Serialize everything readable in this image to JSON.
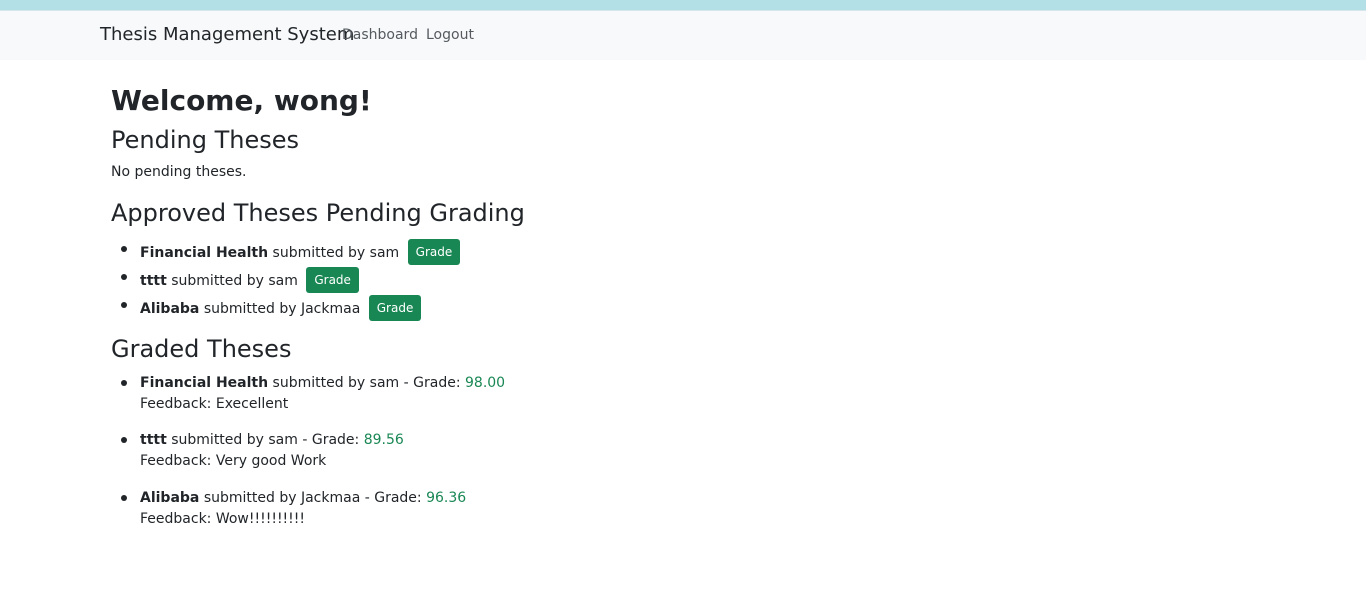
{
  "navbar": {
    "brand": "Thesis Management System",
    "links": [
      "Dashboard",
      "Logout"
    ]
  },
  "welcome": "Welcome, wong!",
  "pending": {
    "heading": "Pending Theses",
    "empty_text": "No pending theses."
  },
  "approved": {
    "heading": "Approved Theses Pending Grading",
    "connector": "submitted by",
    "button_label": "Grade",
    "items": [
      {
        "title": "Financial Health",
        "author": "sam"
      },
      {
        "title": "tttt",
        "author": "sam"
      },
      {
        "title": "Alibaba",
        "author": "Jackmaa"
      }
    ]
  },
  "graded": {
    "heading": "Graded Theses",
    "connector": "submitted by",
    "grade_prefix": "- Grade:",
    "feedback_prefix": "Feedback:",
    "items": [
      {
        "title": "Financial Health",
        "author": "sam",
        "grade": "98.00",
        "feedback": "Execellent"
      },
      {
        "title": "tttt",
        "author": "sam",
        "grade": "89.56",
        "feedback": "Very good Work"
      },
      {
        "title": "Alibaba",
        "author": "Jackmaa",
        "grade": "96.36",
        "feedback": "Wow!!!!!!!!!!"
      }
    ]
  },
  "colors": {
    "accent_green": "#198754",
    "navbar_bg": "#f8f9fa",
    "top_strip": "#b2e0e6"
  }
}
